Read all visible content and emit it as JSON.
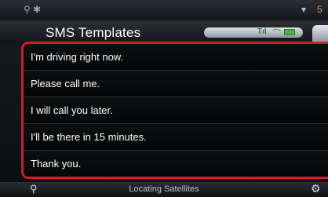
{
  "status_bar": {
    "usb_icon": "usb-icon",
    "bluetooth_icon": "bluetooth-icon",
    "wifi_icon": "wifi-icon",
    "right_number": "5"
  },
  "header": {
    "title": "SMS Templates",
    "phone_status_icons": [
      "signal-strength-icon",
      "call-icon",
      "battery-icon"
    ]
  },
  "templates": [
    "I'm driving right now.",
    "Please call me.",
    "I will call you later.",
    "I'll be there in 15 minutes.",
    "Thank you."
  ],
  "bottom_bar": {
    "status_text": "Locating Satellites",
    "left_icon": "contact-search-icon",
    "right_icon": "settings-icon"
  },
  "colors": {
    "selection_outline": "#d71a27",
    "phone_icons": "#2b7a2b"
  }
}
